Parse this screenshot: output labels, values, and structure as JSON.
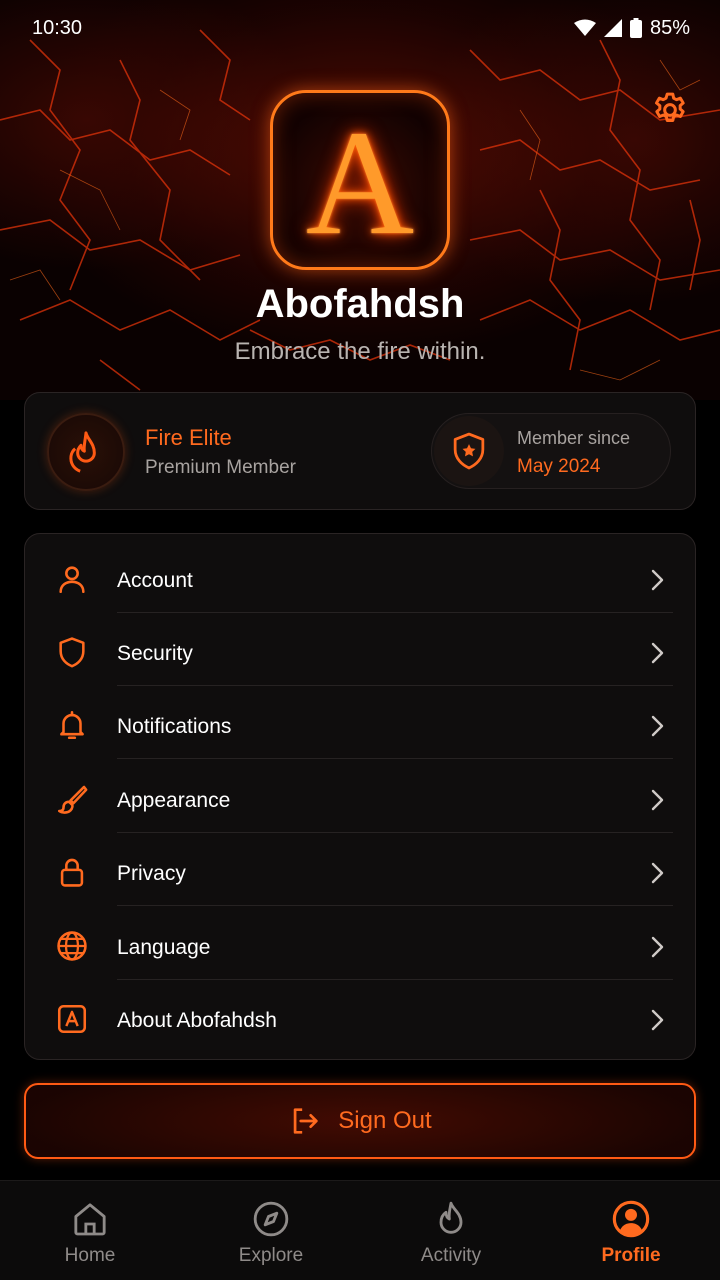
{
  "status_bar": {
    "time": "10:30",
    "battery": "85%"
  },
  "profile": {
    "logo_letter": "A",
    "name": "Abofahdsh",
    "tagline": "Embrace the fire within."
  },
  "membership": {
    "tier": "Fire Elite",
    "tier_subtitle": "Premium Member",
    "since_label": "Member since",
    "since_value": "May 2024"
  },
  "menu": {
    "items": [
      {
        "label": "Account",
        "icon": "user-icon"
      },
      {
        "label": "Security",
        "icon": "shield-icon"
      },
      {
        "label": "Notifications",
        "icon": "bell-icon"
      },
      {
        "label": "Appearance",
        "icon": "brush-icon"
      },
      {
        "label": "Privacy",
        "icon": "lock-icon"
      },
      {
        "label": "Language",
        "icon": "globe-icon"
      },
      {
        "label": "About Abofahdsh",
        "icon": "app-logo-icon"
      }
    ]
  },
  "sign_out": {
    "label": "Sign Out"
  },
  "tabs": [
    {
      "label": "Home",
      "icon": "home-icon",
      "active": false
    },
    {
      "label": "Explore",
      "icon": "compass-icon",
      "active": false
    },
    {
      "label": "Activity",
      "icon": "flame-icon",
      "active": false
    },
    {
      "label": "Profile",
      "icon": "profile-icon",
      "active": true
    }
  ],
  "colors": {
    "accent": "#ff6a1f",
    "background": "#000000",
    "card": "#0f0d0d"
  }
}
